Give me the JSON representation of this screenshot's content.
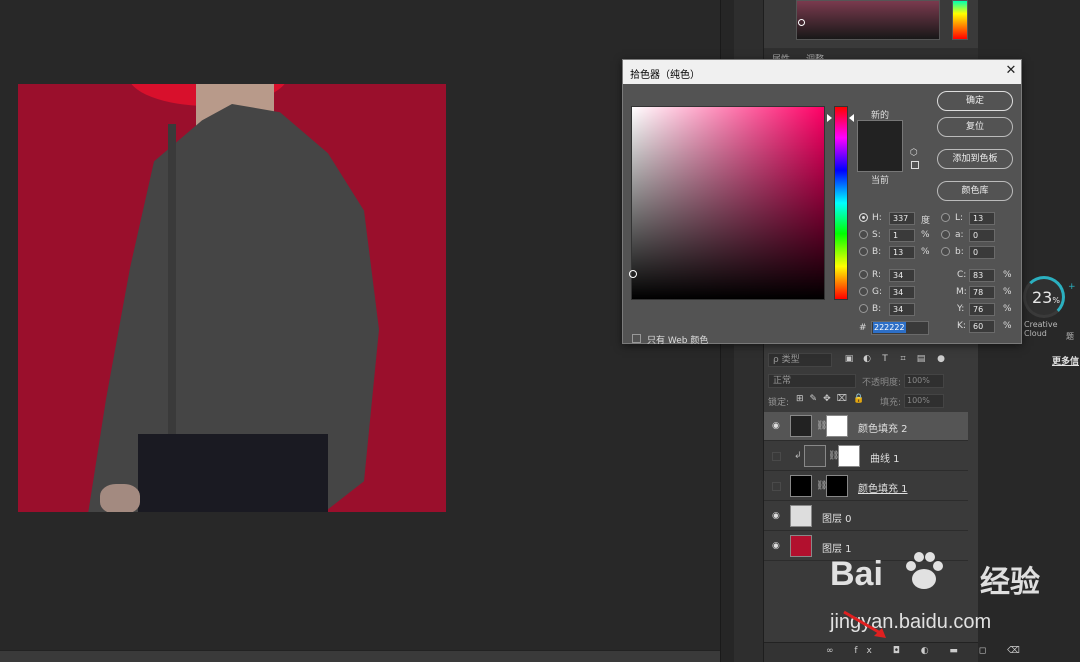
{
  "dialog": {
    "title": "拾色器（纯色）",
    "close_glyph": "✕",
    "new_label": "新的",
    "current_label": "当前",
    "new_color": "#222222",
    "current_color": "#222222",
    "buttons": {
      "ok": "确定",
      "reset": "复位",
      "add_swatch": "添加到色板",
      "color_libraries": "颜色库"
    },
    "hsb": {
      "h": {
        "label": "H:",
        "value": "337",
        "unit": "度"
      },
      "s": {
        "label": "S:",
        "value": "1",
        "unit": "%"
      },
      "b": {
        "label": "B:",
        "value": "13",
        "unit": "%"
      }
    },
    "rgb": {
      "r": {
        "label": "R:",
        "value": "34"
      },
      "g": {
        "label": "G:",
        "value": "34"
      },
      "b": {
        "label": "B:",
        "value": "34"
      }
    },
    "lab": {
      "l": {
        "label": "L:",
        "value": "13"
      },
      "a": {
        "label": "a:",
        "value": "0"
      },
      "b": {
        "label": "b:",
        "value": "0"
      }
    },
    "cmyk": {
      "c": {
        "label": "C:",
        "value": "83",
        "unit": "%"
      },
      "m": {
        "label": "M:",
        "value": "78",
        "unit": "%"
      },
      "y": {
        "label": "Y:",
        "value": "76",
        "unit": "%"
      },
      "k": {
        "label": "K:",
        "value": "60",
        "unit": "%"
      }
    },
    "hex_label": "#",
    "hex_value": "222222",
    "web_only_label": "只有 Web 颜色",
    "selected_channel": "H"
  },
  "properties_tabs": [
    "属性",
    "调整"
  ],
  "layers": {
    "filter_label": "ρ 类型",
    "blend_mode": "正常",
    "opacity_label": "不透明度:",
    "opacity_value": "100%",
    "lock_label": "锁定:",
    "fill_label": "填充:",
    "fill_value": "100%",
    "items": [
      {
        "name": "颜色填充 2",
        "visible": true,
        "selected": true,
        "color": "#222222"
      },
      {
        "name": "曲线 1",
        "visible": false,
        "selected": false,
        "color": "#ffffff"
      },
      {
        "name": "颜色填充 1",
        "visible": false,
        "selected": false,
        "color": "#000000"
      },
      {
        "name": "图层 0",
        "visible": true,
        "selected": false,
        "color": "#dddddd"
      },
      {
        "name": "图层 1",
        "visible": true,
        "selected": false,
        "color": "#b2102e"
      }
    ],
    "bottom_icons": "∞ fx ◘ ◐ ▬ ◻ ⌫"
  },
  "creative_cloud": {
    "percent": "23",
    "percent_unit": "%",
    "label": "Creative Cloud",
    "label2": "题",
    "more_link": "更多信"
  },
  "watermark": {
    "brand_left": "Bai",
    "brand_right": "du",
    "brand_cn": "经验",
    "url": "jingyan.baidu.com"
  },
  "colors": {
    "canvas_bg": "#9a0f2c",
    "accent": "#2bb0c0",
    "hex_highlight": "#2d6fc7"
  }
}
